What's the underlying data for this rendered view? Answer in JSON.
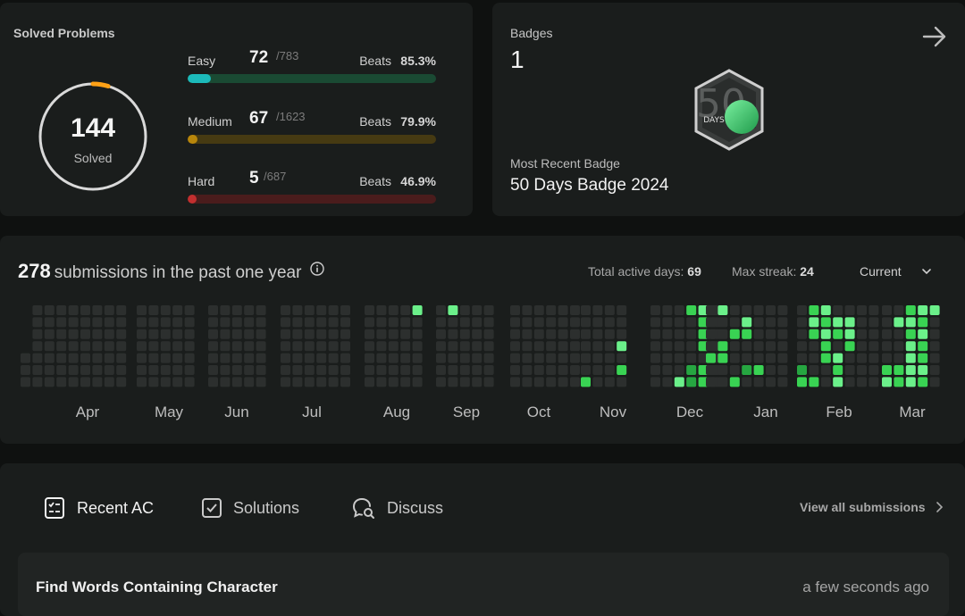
{
  "solved": {
    "title": "Solved Problems",
    "total": "144",
    "total_label": "Solved",
    "ring_progress": 0.0467,
    "difficulties": [
      {
        "name": "Easy",
        "count": "72",
        "total": "/783",
        "beats_label": "Beats",
        "beats": "85.3%",
        "fraction": 0.092,
        "color": "#1cbaba",
        "track": "#1a4a33"
      },
      {
        "name": "Medium",
        "count": "67",
        "total": "/1623",
        "beats_label": "Beats",
        "beats": "79.9%",
        "fraction": 0.041,
        "color": "#b8860b",
        "track": "#463a12"
      },
      {
        "name": "Hard",
        "count": "5",
        "total": "/687",
        "beats_label": "Beats",
        "beats": "46.9%",
        "fraction": 0.007,
        "color": "#c22f2f",
        "track": "#4a1c1c"
      }
    ]
  },
  "badges": {
    "title": "Badges",
    "count": "1",
    "recent_label": "Most Recent Badge",
    "recent_name": "50 Days Badge 2024",
    "badge_icon": "50-days-badge-icon",
    "arrow_icon": "arrow-right-icon",
    "badge_text": {
      "number": "50",
      "unit": "DAYS"
    }
  },
  "heatmap": {
    "count": "278",
    "label": "submissions in the past one year",
    "total_active_label": "Total active days:",
    "total_active": "69",
    "max_streak_label": "Max streak:",
    "max_streak": "24",
    "period": "Current",
    "months": [
      "Apr",
      "May",
      "Jun",
      "Jul",
      "Aug",
      "Sep",
      "Oct",
      "Nov",
      "Dec",
      "Jan",
      "Feb",
      "Mar"
    ],
    "colors": {
      "empty": "#2c2f2e",
      "l1": "#0e4429",
      "l2": "#26a641",
      "l3": "#39d353",
      "l4": "#6bf08a"
    }
  },
  "recent": {
    "tabs": [
      {
        "label": "Recent AC",
        "icon": "checklist-icon"
      },
      {
        "label": "Solutions",
        "icon": "checkbox-icon"
      },
      {
        "label": "Discuss",
        "icon": "discuss-icon"
      }
    ],
    "view_all": "View all submissions",
    "items": [
      {
        "title": "Find Words Containing Character",
        "time": "a few seconds ago"
      }
    ]
  }
}
